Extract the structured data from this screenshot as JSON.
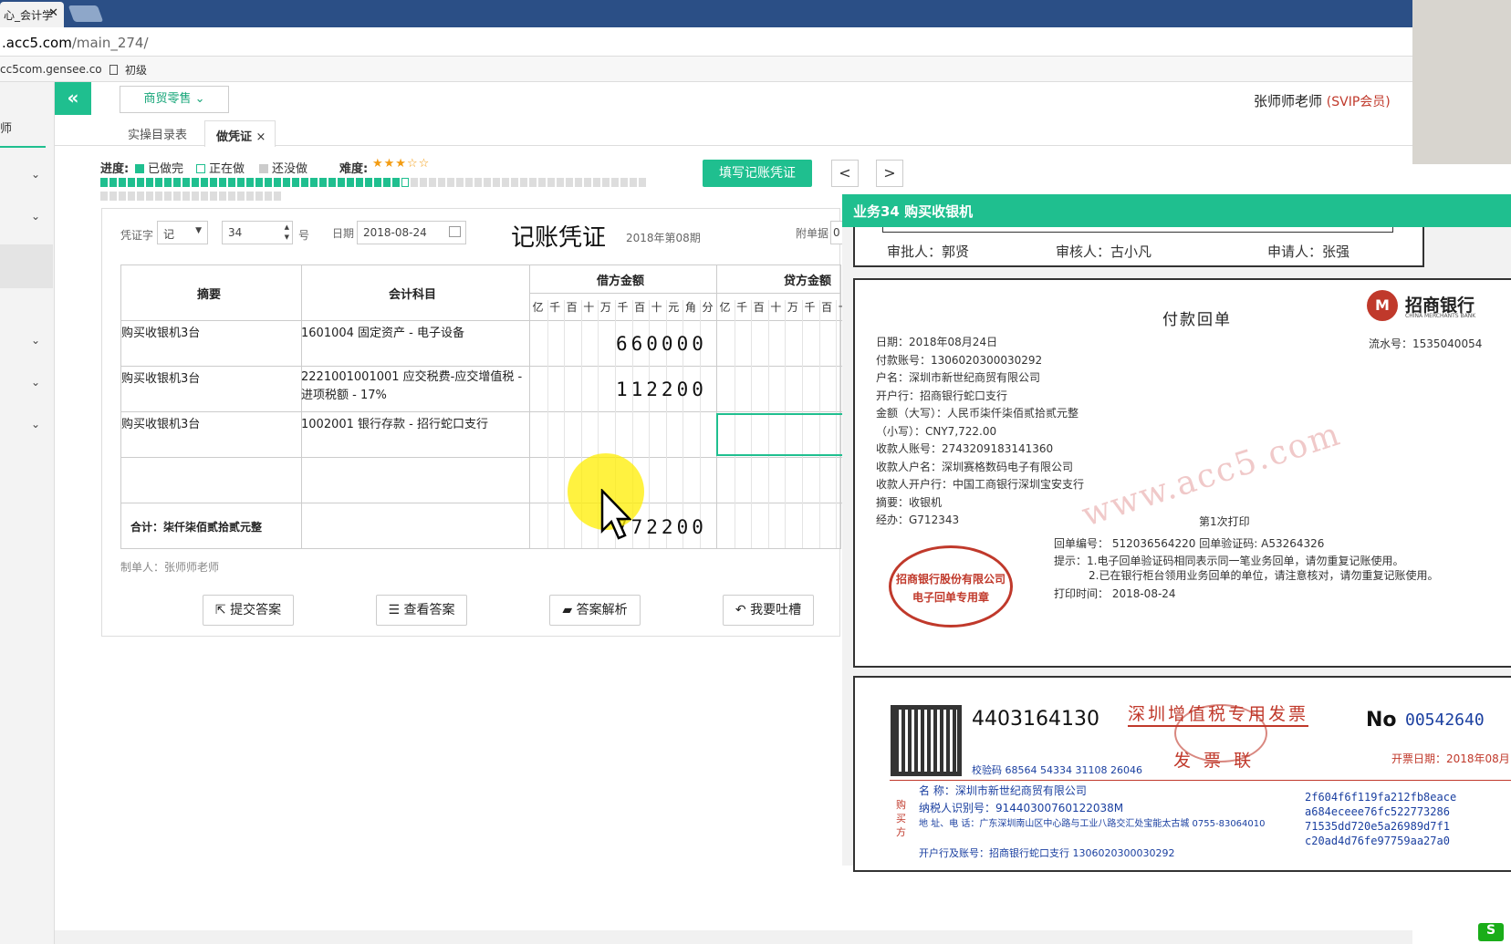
{
  "browser": {
    "tab_title": "心_会计学",
    "address_domain": ".acc5.com",
    "address_path": "/main_274/",
    "bookmarks": [
      "cc5com.gensee.co",
      "初级"
    ]
  },
  "sidebar": {
    "label": "师"
  },
  "header": {
    "collapse_icon": "«",
    "biz_select": "商贸零售",
    "user_name": "张师师老师",
    "user_level": "(SVIP会员)"
  },
  "subtabs": {
    "catalog": "实操目录表",
    "voucher": "做凭证",
    "close": "×"
  },
  "progress": {
    "label": "进度:",
    "done": "已做完",
    "doing": "正在做",
    "todo": "还没做",
    "difficulty_label": "难度:",
    "difficulty_stars": "★★★☆☆",
    "done_count": 34,
    "total_count": 80
  },
  "toolbar": {
    "fill_voucher": "填写记账凭证",
    "prev": "<",
    "next": ">"
  },
  "voucher": {
    "word_label": "凭证字",
    "word_value": "记",
    "number_value": "34",
    "number_suffix": "号",
    "date_label": "日期",
    "date_value": "2018-08-24",
    "title": "记账凭证",
    "period": "2018年第08期",
    "attach_label": "附单据",
    "attach_value": "0",
    "col_summary": "摘要",
    "col_account": "会计科目",
    "col_debit": "借方金额",
    "col_credit": "贷方金额",
    "units": [
      "亿",
      "千",
      "百",
      "十",
      "万",
      "千",
      "百",
      "十",
      "元",
      "角",
      "分"
    ],
    "rows": [
      {
        "summary": "购买收银机3台",
        "account": "1601004 固定资产 - 电子设备",
        "debit": "660000"
      },
      {
        "summary": "购买收银机3台",
        "account": "2221001001001 应交税费-应交增值税 - 进项税额 - 17%",
        "debit": "112200"
      },
      {
        "summary": "购买收银机3台",
        "account": "1002001 银行存款 - 招行蛇口支行",
        "debit": ""
      }
    ],
    "total_label": "合计：柒仟柒佰贰拾贰元整",
    "total_debit": "772200",
    "maker": "制单人：张师师老师"
  },
  "actions": {
    "submit": "提交答案",
    "view": "查看答案",
    "analysis": "答案解析",
    "feedback": "我要吐槽"
  },
  "doc": {
    "title": "业务34 购买收银机",
    "approver": "审批人：郭贤",
    "reviewer": "审核人：古小凡",
    "applicant": "申请人：张强",
    "bank_name": "招商银行",
    "bank_en": "CHINA MERCHANTS BANK",
    "receipt_title": "付款回单",
    "serial": "流水号：1535040054",
    "lines": [
      "日期：2018年08月24日",
      "付款账号：1306020300030292",
      "户名：深圳市新世纪商贸有限公司",
      "开户行：招商银行蛇口支行",
      "金额（大写）：人民币柒仟柒佰贰拾贰元整",
      "（小写）：CNY7,722.00",
      "收款人账号：2743209183141360",
      "收款人户名：深圳赛格数码电子有限公司",
      "收款人开户行：中国工商银行深圳宝安支行",
      "摘要：收银机",
      "经办：G712343"
    ],
    "print_count": "第1次打印",
    "receipt_no": "回单编号： 512036564220 回单验证码: A53264326",
    "notice1": "提示：1.电子回单验证码相同表示同一笔业务回单，请勿重复记账使用。",
    "notice2": "2.已在银行柜台领用业务回单的单位，请注意核对，请勿重复记账使用。",
    "print_time": "打印时间： 2018-08-24",
    "stamp_line1": "招商银行股份有限公司",
    "stamp_line2": "电子回单专用章",
    "watermark": "www.acc5.com",
    "invoice_code": "4403164130",
    "invoice_title": "深圳增值税专用发票",
    "invoice_sub": "发 票 联",
    "invoice_no_label": "No",
    "invoice_no": "00542640",
    "invoice_date": "开票日期：2018年08月",
    "check_code": "校验码 68564 54334 31108 26046",
    "buyer_label": "购买方",
    "buyer_name": "名 称：深圳市新世纪商贸有限公司",
    "buyer_tax": "纳税人识别号：91440300760122038M",
    "buyer_addr": "地 址、电 话：广东深圳南山区中心路与工业八路交汇处宝能太古城 0755-83064010",
    "buyer_bank": "开户行及账号：招商银行蛇口支行 1306020300030292",
    "cipher": [
      "2f604f6f119fa212fb8eace",
      "a684eceee76fc522773286",
      "71535dd720e5a26989d7f1",
      "c20ad4d76fe97759aa27a0"
    ]
  }
}
